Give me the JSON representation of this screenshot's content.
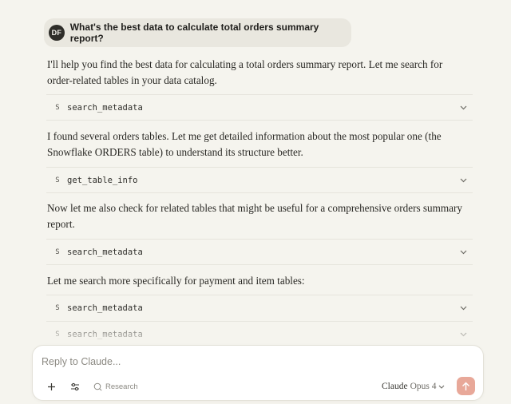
{
  "user_message": {
    "avatar_initials": "DF",
    "text": "What's the best data to calculate total orders summary report?"
  },
  "assistant_blocks": {
    "p1": "I'll help you find the best data for calculating a total orders summary report. Let me search for order-related tables in your data catalog.",
    "tool1": {
      "icon": "S",
      "name": "search_metadata"
    },
    "p2": "I found several orders tables. Let me get detailed information about the most popular one (the Snowflake ORDERS table) to understand its structure better.",
    "tool2": {
      "icon": "S",
      "name": "get_table_info"
    },
    "p3": "Now let me also check for related tables that might be useful for a comprehensive orders summary report.",
    "tool3": {
      "icon": "S",
      "name": "search_metadata"
    },
    "p4": "Let me search more specifically for payment and item tables:",
    "tool4": {
      "icon": "S",
      "name": "search_metadata"
    },
    "tool5": {
      "icon": "S",
      "name": "search_metadata"
    }
  },
  "composer": {
    "placeholder": "Reply to Claude...",
    "research_label": "Research",
    "model_name": "Claude",
    "model_version": "Opus 4"
  },
  "colors": {
    "background": "#f5f4ee",
    "user_bubble": "#e9e7df",
    "send_button": "#e8a899"
  }
}
